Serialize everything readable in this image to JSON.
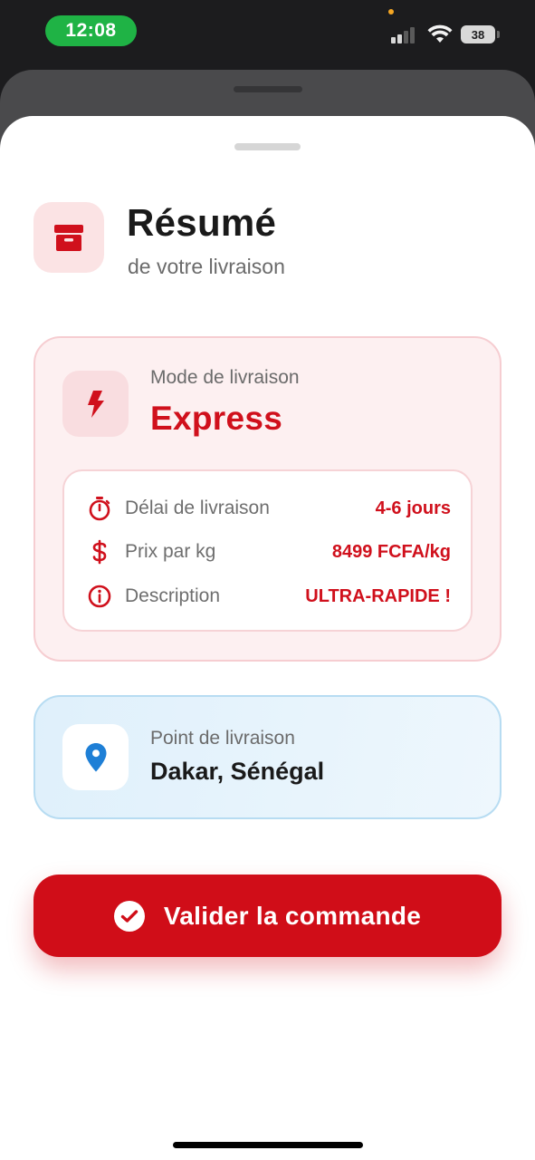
{
  "status_bar": {
    "time": "12:08",
    "battery": "38"
  },
  "header": {
    "title": "Résumé",
    "subtitle": "de votre livraison",
    "icon": "archive-box-icon"
  },
  "delivery_mode": {
    "label": "Mode de livraison",
    "value": "Express",
    "icon": "lightning-icon",
    "details": [
      {
        "icon": "stopwatch-icon",
        "label": "Délai de livraison",
        "value": "4-6 jours"
      },
      {
        "icon": "dollar-icon",
        "label": "Prix par kg",
        "value": "8499 FCFA/kg"
      },
      {
        "icon": "info-icon",
        "label": "Description",
        "value": "ULTRA-RAPIDE !"
      }
    ]
  },
  "delivery_point": {
    "label": "Point de livraison",
    "value": "Dakar, Sénégal",
    "icon": "map-pin-icon"
  },
  "action": {
    "label": "Valider la commande",
    "icon": "check-circle-icon"
  },
  "colors": {
    "accent": "#d0101c",
    "info_blue": "#1e7fd6",
    "status_green": "#1fb345"
  }
}
